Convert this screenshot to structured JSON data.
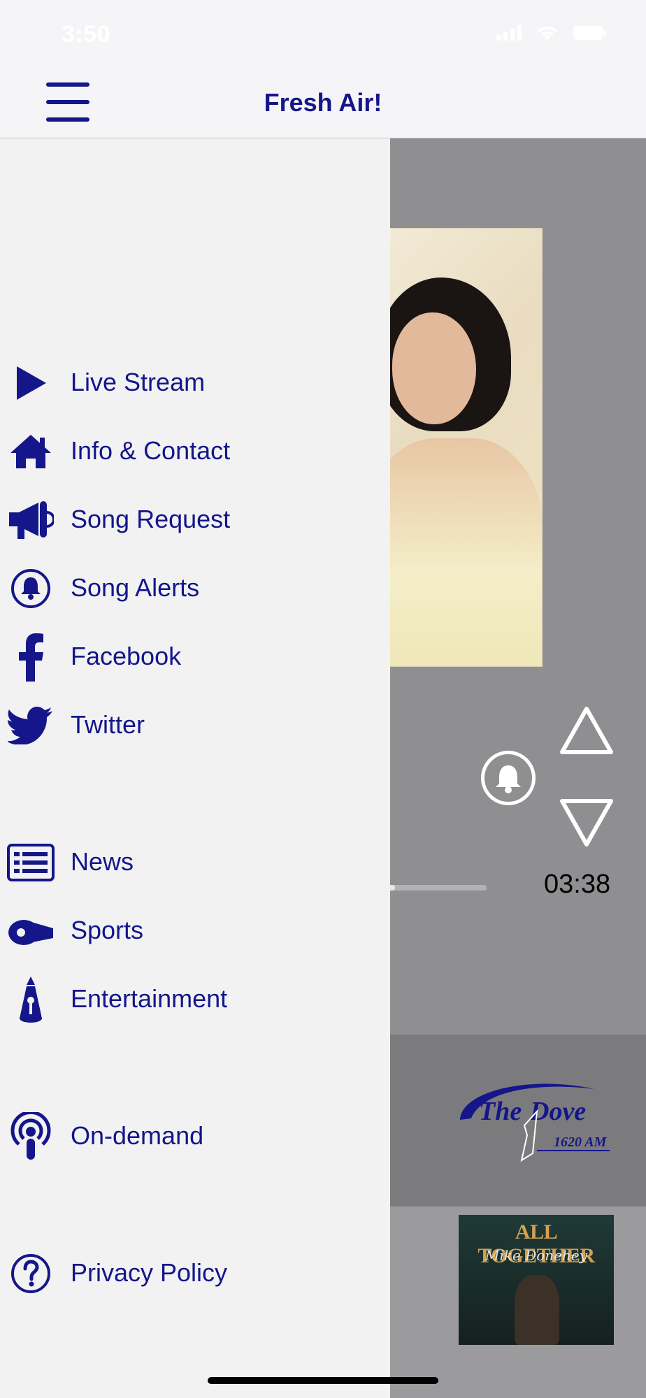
{
  "status_bar": {
    "time": "3:50"
  },
  "header": {
    "title": "Fresh Air!"
  },
  "player": {
    "elapsed_time": "03:38",
    "progress_fraction": 0.16
  },
  "station": {
    "logo_line1": "The",
    "logo_line2": "Dove",
    "logo_freq": "1620 AM"
  },
  "album": {
    "title": "ALL TOGETHER",
    "artist": "Mike Donehey"
  },
  "drawer": {
    "items": [
      {
        "label": "Live Stream",
        "icon": "play-icon"
      },
      {
        "label": "Info & Contact",
        "icon": "home-icon"
      },
      {
        "label": "Song Request",
        "icon": "megaphone-icon"
      },
      {
        "label": "Song Alerts",
        "icon": "bell-icon"
      },
      {
        "label": "Facebook",
        "icon": "facebook-icon"
      },
      {
        "label": "Twitter",
        "icon": "twitter-icon"
      },
      {
        "label": "News",
        "icon": "news-icon"
      },
      {
        "label": "Sports",
        "icon": "whistle-icon"
      },
      {
        "label": "Entertainment",
        "icon": "spotlight-icon"
      },
      {
        "label": "On-demand",
        "icon": "podcast-icon"
      },
      {
        "label": "Privacy Policy",
        "icon": "question-icon"
      }
    ]
  },
  "colors": {
    "accent": "#14168a",
    "drawer_bg": "#f2f2f3",
    "player_bg": "#8f8f92"
  }
}
